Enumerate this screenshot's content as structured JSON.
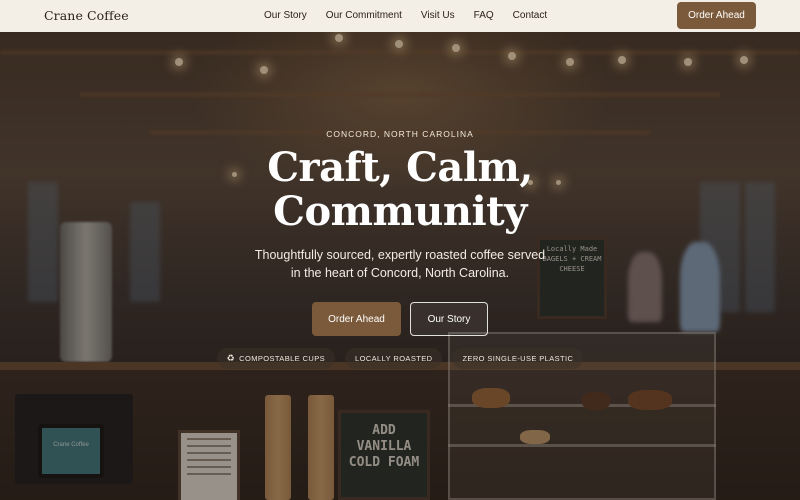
{
  "brand": {
    "name": "Crane Coffee"
  },
  "nav": {
    "links": [
      "Our Story",
      "Our Commitment",
      "Visit Us",
      "FAQ",
      "Contact"
    ],
    "cta": "Order Ahead"
  },
  "hero": {
    "eyebrow": "CONCORD, NORTH CAROLINA",
    "headline_line1": "Craft, Calm,",
    "headline_line2": "Community",
    "subtext": "Thoughtfully sourced, expertly roasted coffee served in the heart of Concord, North Carolina.",
    "primary_cta": "Order Ahead",
    "secondary_cta": "Our Story",
    "badges": [
      {
        "label": "COMPOSTABLE CUPS",
        "icon": "recycle-icon"
      },
      {
        "label": "LOCALLY ROASTED"
      },
      {
        "label": "ZERO SINGLE-USE PLASTIC"
      }
    ]
  },
  "scene": {
    "chalkboard_top": "Locally Made BAGELS + CREAM CHEESE",
    "chalkboard_front": "ADD VANILLA COLD FOAM",
    "tablet_label": "Crane Coffee"
  },
  "colors": {
    "accent": "#7a5a3a",
    "nav_bg": "#f4efe6"
  }
}
